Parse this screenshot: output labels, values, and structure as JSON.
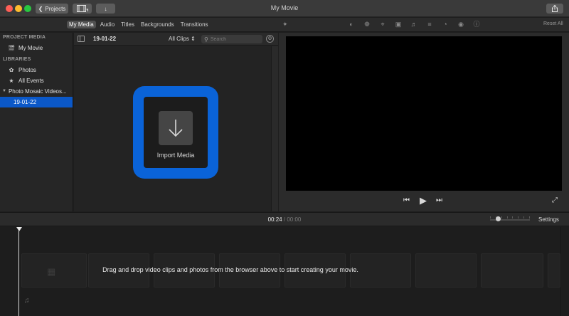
{
  "window": {
    "title": "My Movie",
    "projects_label": "Projects",
    "back_icon": "chevron-left-icon",
    "media_view_icon": "film-strip-icon",
    "import_icon": "download-arrow-icon",
    "share_icon": "share-icon"
  },
  "tabs": [
    {
      "label": "My Media",
      "active": true
    },
    {
      "label": "Audio",
      "active": false
    },
    {
      "label": "Titles",
      "active": false
    },
    {
      "label": "Backgrounds",
      "active": false
    },
    {
      "label": "Transitions",
      "active": false
    }
  ],
  "adjustments": {
    "icons": [
      "magic-wand-icon",
      "color-balance-icon",
      "color-correction-icon",
      "crop-icon",
      "stabilization-icon",
      "volume-icon",
      "noise-reduction-icon",
      "speed-icon",
      "clip-filter-icon",
      "info-icon"
    ],
    "reset_label": "Reset All"
  },
  "sidebar": {
    "project_media_header": "PROJECT MEDIA",
    "project_item": "My Movie",
    "libraries_header": "LIBRARIES",
    "library_items": [
      "Photos",
      "All Events"
    ],
    "library_name": "Photo Mosaic Videos...",
    "selected_event": "19-01-22"
  },
  "browser": {
    "event_title": "19-01-22",
    "filter_label": "All Clips",
    "search_placeholder": "Search",
    "import_label": "Import Media"
  },
  "timeline": {
    "current_time": "00:24",
    "separator": "/",
    "total_time": "00:00",
    "settings_label": "Settings",
    "drop_hint": "Drag and drop video clips and photos from the browser above to start creating your movie."
  },
  "colors": {
    "accent": "#0a63d8",
    "selection": "#0b58c8",
    "background": "#1e1e1e"
  }
}
